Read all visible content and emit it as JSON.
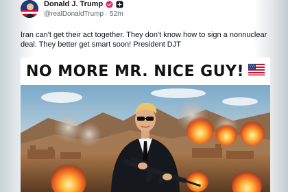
{
  "post": {
    "author_name": "Donald J. Trump",
    "handle": "@realDonaldTrump",
    "separator": "·",
    "time_ago": "52m",
    "text": "Iran can't get their act together. They don't know how to sign a nonnuclear deal. They better get smart soon! President DJT",
    "verified_badge_color": "#e0245e",
    "follow_badge_color": "#0f1419"
  },
  "media": {
    "headline": "NO MORE MR. NICE GUY!",
    "headline_emoji": "us-flag",
    "scene_icons": [
      "desert-mountains",
      "explosion",
      "soldier-figure",
      "rifle",
      "fortress-ruins"
    ]
  }
}
